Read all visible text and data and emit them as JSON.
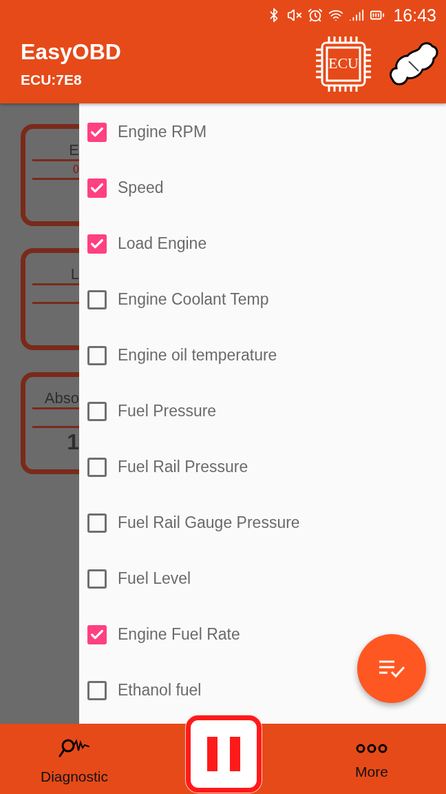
{
  "status_bar": {
    "time": "16:43"
  },
  "app_bar": {
    "title": "EasyOBD",
    "subtitle": "ECU:7E8",
    "ecu_button": "ECU"
  },
  "background_cards": [
    {
      "title": "E",
      "value": "0"
    },
    {
      "title": "L"
    },
    {
      "title": "Abso",
      "reading": "1"
    }
  ],
  "sensor_list": [
    {
      "label": "Engine RPM",
      "checked": true
    },
    {
      "label": "Speed",
      "checked": true
    },
    {
      "label": "Load Engine",
      "checked": true
    },
    {
      "label": "Engine Coolant Temp",
      "checked": false
    },
    {
      "label": "Engine oil temperature",
      "checked": false
    },
    {
      "label": "Fuel Pressure",
      "checked": false
    },
    {
      "label": "Fuel Rail Pressure",
      "checked": false
    },
    {
      "label": "Fuel Rail Gauge Pressure",
      "checked": false
    },
    {
      "label": "Fuel Level",
      "checked": false
    },
    {
      "label": "Engine Fuel Rate",
      "checked": true
    },
    {
      "label": "Ethanol fuel",
      "checked": false
    }
  ],
  "bottom_nav": [
    {
      "kind": "diagnostic",
      "label": "Diagnostic"
    },
    {
      "kind": "pause"
    },
    {
      "kind": "more",
      "label": "More"
    }
  ]
}
